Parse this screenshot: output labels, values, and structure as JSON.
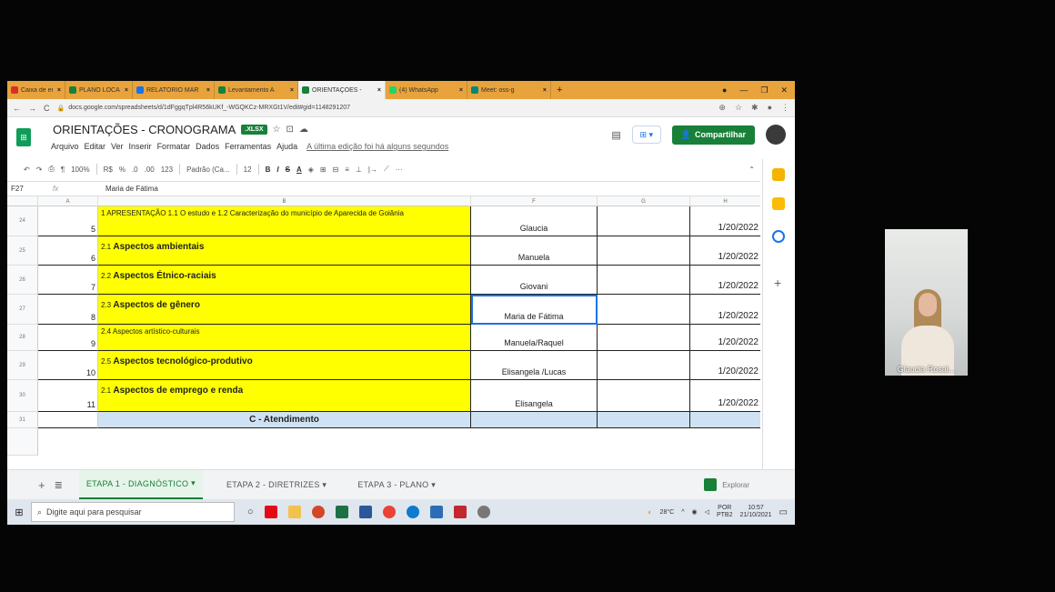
{
  "browser": {
    "tabs": [
      {
        "label": "Caixa de entrada",
        "color": "#d93025"
      },
      {
        "label": "PLANO LOCAL D",
        "color": "#188038"
      },
      {
        "label": "RELATÓRIO MAR",
        "color": "#1a73e8"
      },
      {
        "label": "Levantamento A",
        "color": "#188038"
      },
      {
        "label": "ORIENTAÇÕES -",
        "color": "#188038",
        "active": true
      },
      {
        "label": "(4) WhatsApp",
        "color": "#25d366"
      },
      {
        "label": "Meet: oss-g",
        "color": "#00897b"
      }
    ],
    "new_tab": "+",
    "url": "docs.google.com/spreadsheets/d/1dFggqTpl4R56kUKf_-WGQKCz-MRXGt1V/edit#gid=1148291207"
  },
  "doc": {
    "title": "ORIENTAÇÕES - CRONOGRAMA",
    "badge": ".XLSX",
    "menu": [
      "Arquivo",
      "Editar",
      "Ver",
      "Inserir",
      "Formatar",
      "Dados",
      "Ferramentas",
      "Ajuda"
    ],
    "last_edit": "A última edição foi há alguns segundos",
    "share_label": "Compartilhar"
  },
  "toolbar": {
    "zoom": "100%",
    "currency": "R$",
    "percent": "%",
    "dec_less": ".0",
    "dec_more": ".00",
    "format_123": "123",
    "font": "Padrão (Ca...",
    "font_size": "12"
  },
  "formula": {
    "cell": "F27",
    "fx": "fx",
    "value": "Maria de Fátima"
  },
  "columns": [
    "A",
    "B",
    "F",
    "G",
    "H"
  ],
  "rows": [
    {
      "row": "24",
      "num": "5",
      "topic": "1 APRESENTAÇÃO 1.1 O estudo e 1.2 Caracterização do município de Aparecida de Goiânia",
      "style": "small",
      "person": "Glaucia",
      "date": "1/20/2022"
    },
    {
      "row": "25",
      "num": "6",
      "topic_num": "2.1 ",
      "topic": "Aspectos ambientais",
      "style": "bold",
      "person": "Manuela",
      "date": "1/20/2022"
    },
    {
      "row": "26",
      "num": "7",
      "topic_num": "2.2 ",
      "topic": "Aspectos Étnico-raciais",
      "style": "bold",
      "person": "Giovani",
      "date": "1/20/2022"
    },
    {
      "row": "27",
      "num": "8",
      "topic_num": "2.3 ",
      "topic": "Aspectos de gênero",
      "style": "bold",
      "person": "Maria de Fátima",
      "date": "1/20/2022",
      "selected": true
    },
    {
      "row": "28",
      "num": "9",
      "topic": "2.4 Aspectos artístico-culturais",
      "style": "small",
      "person": "Manuela/Raquel",
      "date": "1/20/2022"
    },
    {
      "row": "29",
      "num": "10",
      "topic_num": "2.5 ",
      "topic": "Aspectos tecnológico-produtivo",
      "style": "bold",
      "person": "Elisangela /Lucas",
      "date": "1/20/2022"
    },
    {
      "row": "30",
      "num": "11",
      "topic_num": "2.1 ",
      "topic": "Aspectos de emprego e renda",
      "style": "bold",
      "person": "Elisangela",
      "date": "1/20/2022"
    }
  ],
  "section": {
    "row": "31",
    "label": "C - Atendimento"
  },
  "sheets": {
    "tabs": [
      "ETAPA 1 - DIAGNÓSTICO",
      "ETAPA 2 - DIRETRIZES",
      "ETAPA 3 - PLANO"
    ],
    "explore": "Explorar"
  },
  "taskbar": {
    "search_placeholder": "Digite aqui para pesquisar",
    "weather": "28°C",
    "lang1": "POR",
    "lang2": "PTB2",
    "time": "10:57",
    "date": "21/10/2021"
  },
  "video": {
    "participant": "Glaucia Rosal..."
  }
}
